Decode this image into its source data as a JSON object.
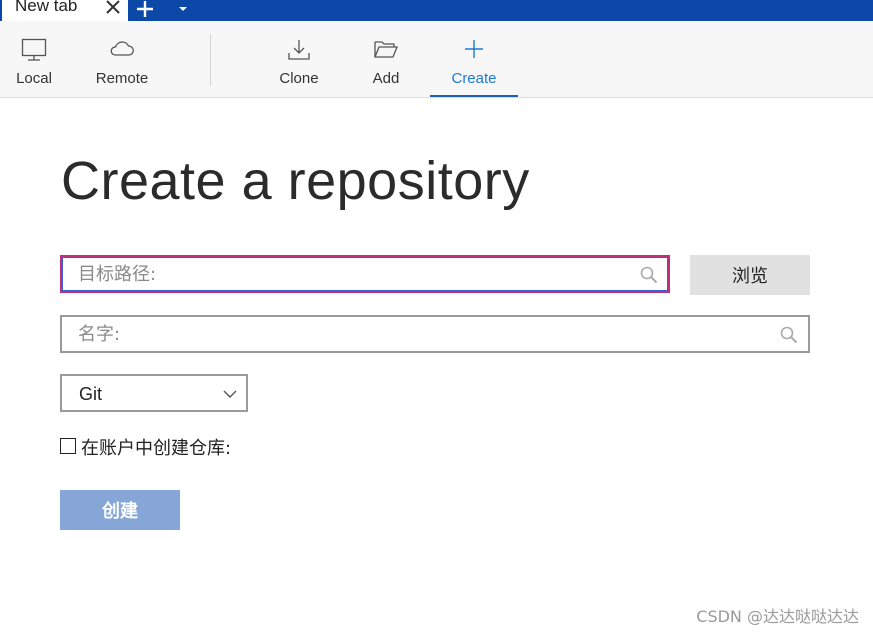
{
  "tab": {
    "label": "New tab"
  },
  "toolbar": {
    "items": [
      {
        "label": "Local",
        "icon": "monitor-icon"
      },
      {
        "label": "Remote",
        "icon": "cloud-icon"
      },
      {
        "label": "Clone",
        "icon": "download-icon"
      },
      {
        "label": "Add",
        "icon": "folder-open-icon"
      },
      {
        "label": "Create",
        "icon": "plus-icon",
        "active": true
      }
    ]
  },
  "main": {
    "title": "Create a repository",
    "path_field": {
      "placeholder": "目标路径:",
      "value": ""
    },
    "browse_label": "浏览",
    "name_field": {
      "placeholder": "名字:",
      "value": ""
    },
    "vcs_select": {
      "value": "Git"
    },
    "account_checkbox": {
      "label": "在账户中创建仓库:",
      "checked": false
    },
    "create_label": "创建"
  },
  "watermark": "CSDN @达达哒哒达达",
  "colors": {
    "tabbar": "#0b48a8",
    "accent": "#1b7ad6",
    "create_button": "#85a6d6",
    "focus_border": "#c0307a"
  }
}
